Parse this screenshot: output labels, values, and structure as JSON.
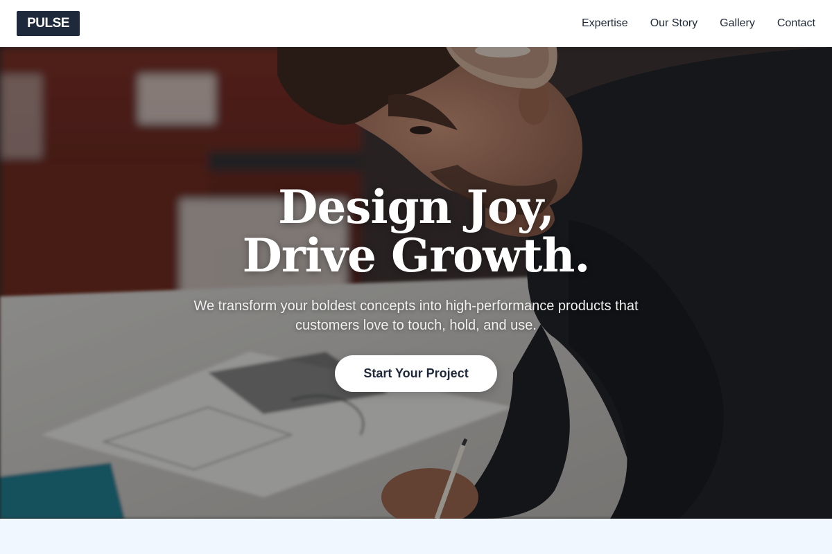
{
  "header": {
    "logo_text": "PULSE",
    "nav": [
      {
        "label": "Expertise"
      },
      {
        "label": "Our Story"
      },
      {
        "label": "Gallery"
      },
      {
        "label": "Contact"
      }
    ]
  },
  "hero": {
    "headline_line1": "Design Joy,",
    "headline_line2": "Drive Growth.",
    "subline": "We transform your boldest concepts into high-performance products that customers love to touch, hold, and use.",
    "cta_label": "Start Your Project",
    "image_subject": "designer with headphones sketching at a desk"
  },
  "colors": {
    "brand_dark": "#1e293b",
    "nav_text": "#1f2937",
    "hero_text": "#ffffff",
    "section_bg": "#f0f7ff"
  }
}
